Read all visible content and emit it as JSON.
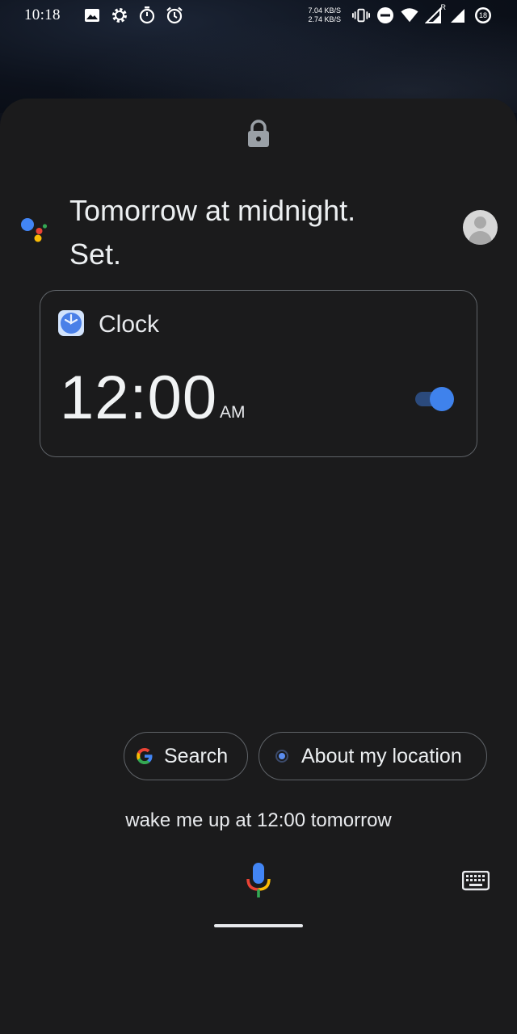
{
  "status_bar": {
    "time": "10:18",
    "net_up": "7.04 KB/S",
    "net_down": "2.74 KB/S",
    "battery_level": "18",
    "roaming_indicator": "R",
    "left_icons": [
      "image-icon",
      "settings-gear-icon",
      "stopwatch-icon",
      "alarm-clock-icon"
    ],
    "right_icons": [
      "vibrate-icon",
      "do-not-disturb-icon",
      "wifi-icon",
      "signal-icon",
      "battery-icon"
    ]
  },
  "assistant": {
    "lock_icon": "lock-icon",
    "response_line1": "Tomorrow at midnight.",
    "response_line2": "Set.",
    "colors": {
      "blue": "#4285F4",
      "red": "#EA4335",
      "yellow": "#FBBC05",
      "green": "#34A853"
    }
  },
  "clock_card": {
    "app_name": "Clock",
    "alarm_time": "12:00",
    "ampm": "AM",
    "alarm_enabled": true,
    "accent": "#3f82ec"
  },
  "suggestions": [
    {
      "label": "Search",
      "icon": "google-g-icon"
    },
    {
      "label": "About my location",
      "icon": "location-dot-icon"
    }
  ],
  "query": {
    "text": "wake me up at 12:00 tomorrow"
  },
  "bottom": {
    "mic_icon": "mic-icon",
    "keyboard_icon": "keyboard-icon"
  }
}
